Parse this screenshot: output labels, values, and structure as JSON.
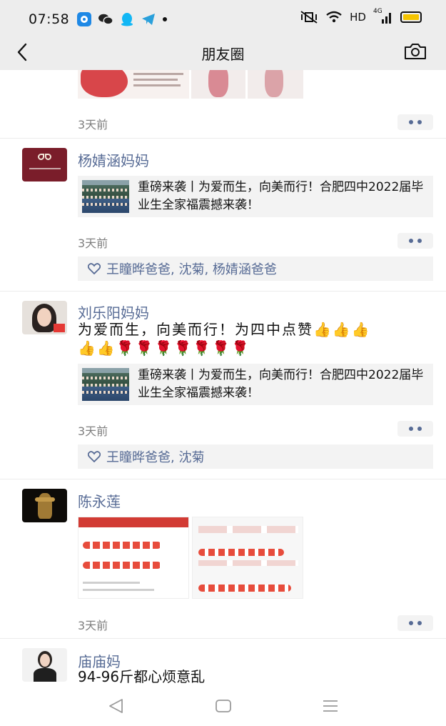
{
  "statusbar": {
    "time": "07:58",
    "network": "HD",
    "signal": "4G",
    "icons": [
      "qq-browser-icon",
      "wechat-icon",
      "qq-icon",
      "telegram-icon"
    ]
  },
  "navbar": {
    "title": "朋友圈"
  },
  "posts": [
    {
      "time": "3天前"
    },
    {
      "name": "杨婧涵妈妈",
      "link_title": "重磅来袭丨为爱而生，向美而行！合肥四中2022届毕业生全家福震撼来袭！",
      "time": "3天前",
      "likes": "王瞳晔爸爸, 沈菊, 杨婧涵爸爸"
    },
    {
      "name": "刘乐阳妈妈",
      "content_line1": "为爱而生，向美而行！为四中点赞👍👍👍",
      "content_line2": "👍👍🌹🌹🌹🌹🌹🌹🌹",
      "link_title": "重磅来袭丨为爱而生，向美而行！合肥四中2022届毕业生全家福震撼来袭！",
      "time": "3天前",
      "likes": "王瞳晔爸爸, 沈菊"
    },
    {
      "name": "陈永莲",
      "time": "3天前"
    },
    {
      "name": "庙庙妈",
      "content": "94-96斤都心烦意乱"
    }
  ],
  "colors": {
    "name_blue": "#576b95",
    "header_bg": "#ededed",
    "card_bg": "#f3f3f3"
  }
}
